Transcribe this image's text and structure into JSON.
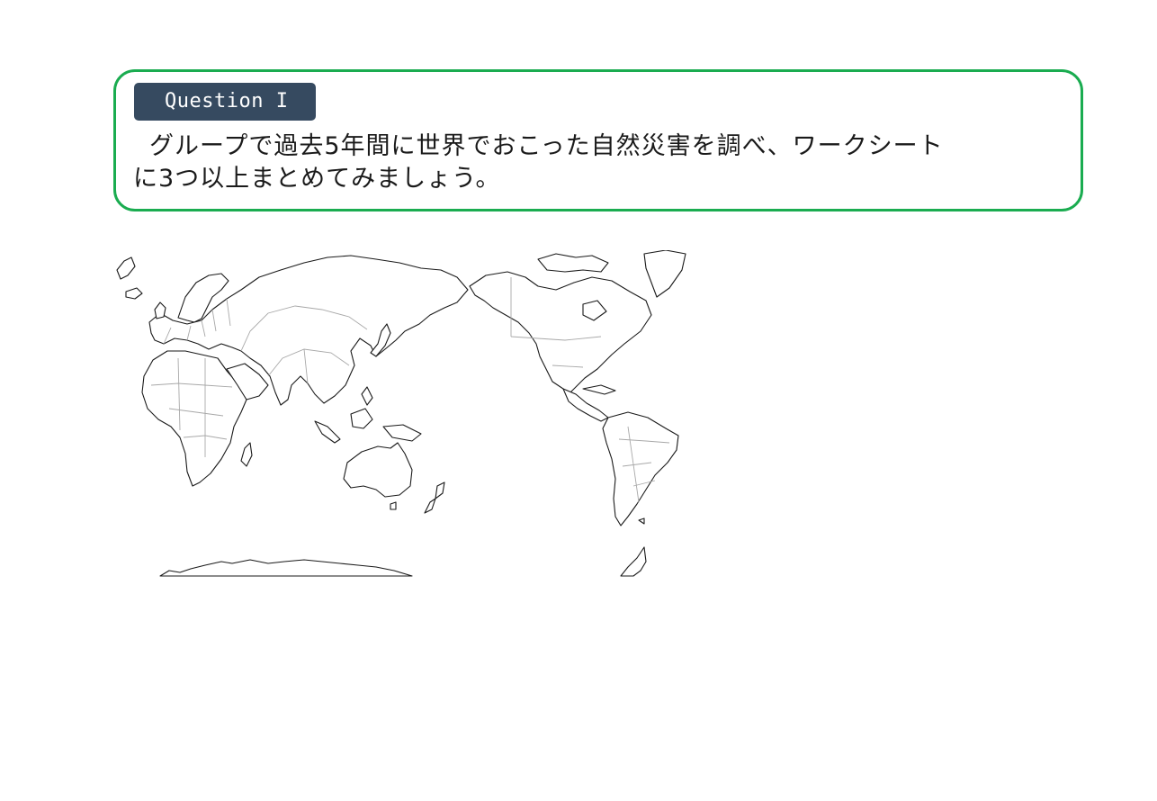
{
  "question": {
    "badge_label": "Question I",
    "text_line1": "グループで過去5年間に世界でおこった自然災害を調べ、ワークシート",
    "text_line2": "に3つ以上まとめてみましょう。"
  },
  "map": {
    "icon": "world-map-pacific-centered",
    "coastline_color": "#1a1a1a",
    "border_color": "#a8a8a8"
  },
  "colors": {
    "frame": "#1aac50",
    "badge": "#364a60",
    "badge_text": "#ffffff",
    "body_text": "#1a1a1a"
  }
}
